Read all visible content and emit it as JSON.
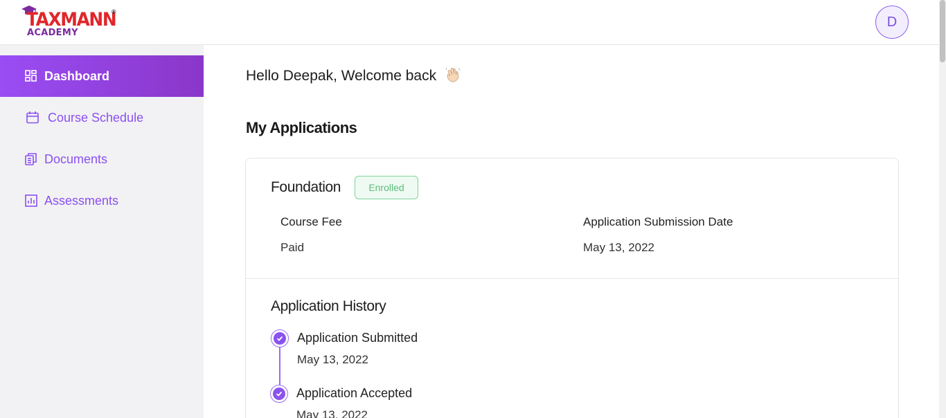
{
  "header": {
    "logo_main": "TAXMANN",
    "logo_reg": "®",
    "logo_sub": "ACADEMY",
    "avatar_initial": "D"
  },
  "sidebar": {
    "items": [
      {
        "label": "Dashboard",
        "icon": "dashboard-icon",
        "active": true
      },
      {
        "label": "Course Schedule",
        "icon": "calendar-icon",
        "active": false
      },
      {
        "label": "Documents",
        "icon": "documents-icon",
        "active": false
      },
      {
        "label": "Assessments",
        "icon": "chart-icon",
        "active": false
      }
    ]
  },
  "main": {
    "greeting": "Hello Deepak, Welcome back",
    "greeting_icon": "waving-hand-icon",
    "section_title": "My Applications",
    "application": {
      "course_name": "Foundation",
      "status": "Enrolled",
      "fields": [
        {
          "label": "Course Fee",
          "value": "Paid"
        },
        {
          "label": "Application Submission Date",
          "value": "May 13, 2022"
        }
      ],
      "history_title": "Application History",
      "history": [
        {
          "title": "Application Submitted",
          "date": "May 13, 2022"
        },
        {
          "title": "Application Accepted",
          "date": "May 13, 2022"
        }
      ]
    }
  },
  "colors": {
    "accent": "#8b50f0",
    "active_gradient_start": "#9a4df4",
    "active_gradient_end": "#8a36c9",
    "enrolled_green": "#5dbb7d",
    "logo_red": "#e0262b",
    "logo_purple": "#7b2b9e"
  }
}
